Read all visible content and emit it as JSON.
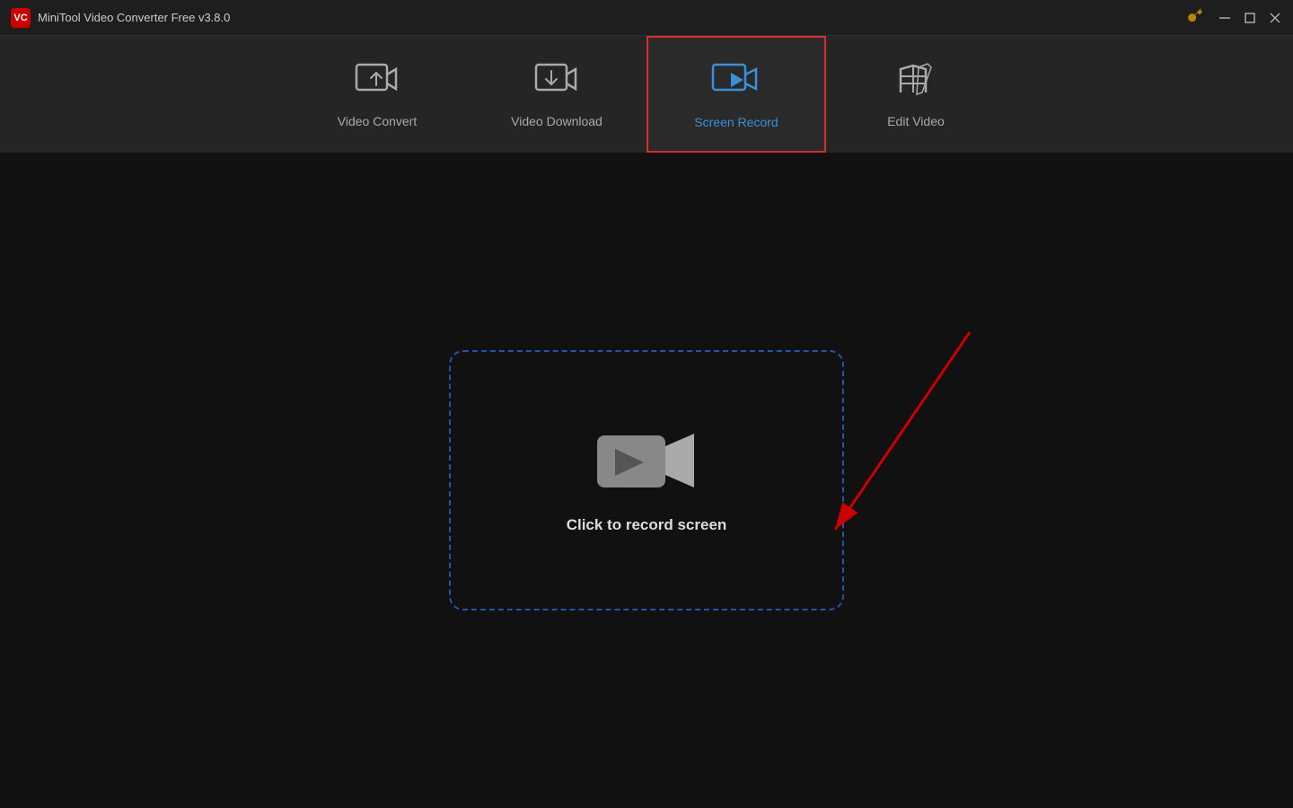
{
  "titleBar": {
    "title": "MiniTool Video Converter Free v3.8.0",
    "logoText": "VC",
    "minimize": "—",
    "maximize": "❑",
    "close": "✕"
  },
  "nav": {
    "tabs": [
      {
        "id": "video-convert",
        "label": "Video Convert",
        "icon": "convert",
        "active": false
      },
      {
        "id": "video-download",
        "label": "Video Download",
        "icon": "download",
        "active": false
      },
      {
        "id": "screen-record",
        "label": "Screen Record",
        "icon": "record",
        "active": true
      },
      {
        "id": "edit-video",
        "label": "Edit Video",
        "icon": "edit",
        "active": false
      }
    ]
  },
  "main": {
    "recordLabel": "Click to record screen"
  }
}
